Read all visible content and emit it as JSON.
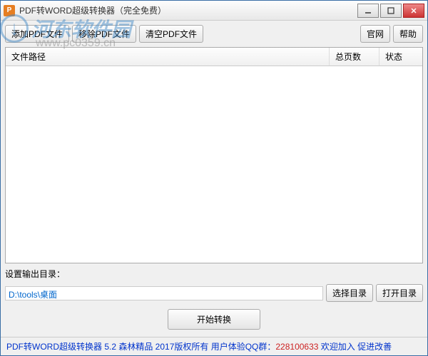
{
  "window": {
    "title": "PDF转WORD超级转换器（完全免费）"
  },
  "toolbar": {
    "add_pdf": "添加PDF文件",
    "remove_pdf": "移除PDF文件",
    "clear_pdf": "清空PDF文件",
    "website": "官网",
    "help": "帮助"
  },
  "table": {
    "headers": {
      "path": "文件路径",
      "pages": "总页数",
      "status": "状态"
    }
  },
  "output": {
    "label": "设置输出目录：",
    "path": "D:\\tools\\桌面",
    "select_dir": "选择目录",
    "open_dir": "打开目录"
  },
  "convert": {
    "start": "开始转换"
  },
  "statusbar": {
    "text_prefix": "PDF转WORD超级转换器 5.2 森林精品 2017版权所有 用户体验QQ群：",
    "qq": "228100633",
    "text_suffix": " 欢迎加入 促进改善"
  },
  "watermark": {
    "text": "河东软件园",
    "sub": "www.pc0359.cn"
  }
}
